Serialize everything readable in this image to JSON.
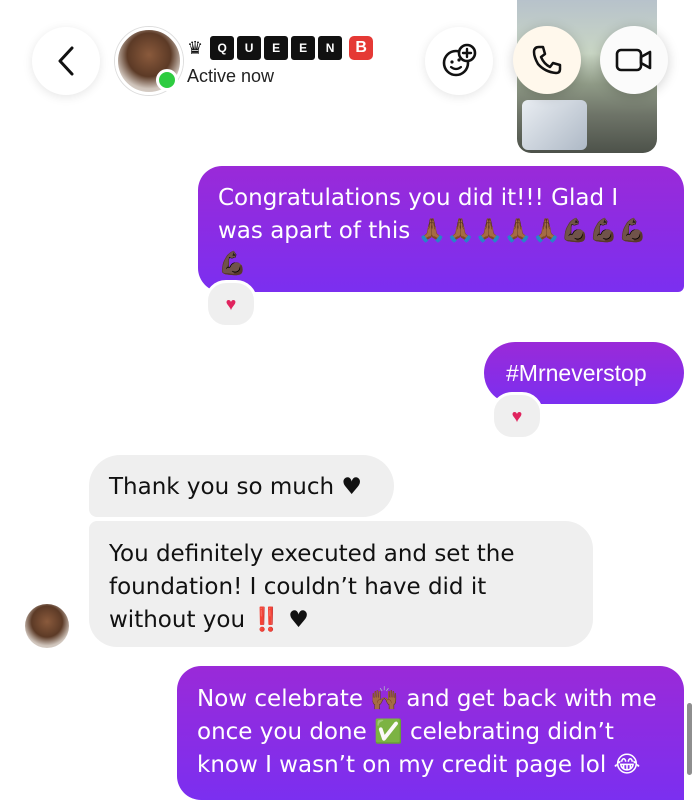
{
  "header": {
    "contact_name_letters": [
      "Q",
      "U",
      "E",
      "E",
      "N"
    ],
    "contact_name_tag": "B",
    "crown_glyph": "♛",
    "status": "Active now",
    "icons": {
      "back": "chevron-left-icon",
      "effects": "face-sparkle-icon",
      "call": "phone-icon",
      "video": "video-camera-icon"
    }
  },
  "messages": [
    {
      "side": "out",
      "text": "Congratulations you did it!!! Glad I was apart of this 🙏🏾🙏🏾🙏🏾🙏🏾🙏🏾💪🏿💪🏿💪🏿💪🏿",
      "reaction": "♥"
    },
    {
      "side": "out",
      "text": "#Mrneverstop",
      "reaction": "♥"
    },
    {
      "side": "in",
      "text": "Thank you so much ♥"
    },
    {
      "side": "in",
      "text": "You definitely executed and set the foundation! I couldn’t have did it without you ‼️ ♥"
    },
    {
      "side": "out",
      "text": "Now celebrate 🙌🏾 and get back with me once you done ✅ celebrating didn’t know I wasn’t on my credit page lol 😂"
    }
  ],
  "colors": {
    "outgoing_bubble": "#8a2be2",
    "incoming_bubble": "#efefef",
    "online": "#2ecc40",
    "heart": "#e0245e",
    "tag_red": "#e53935"
  }
}
